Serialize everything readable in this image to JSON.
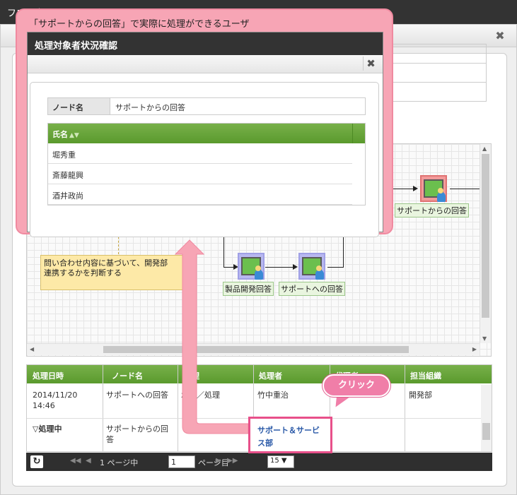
{
  "background": {
    "titlebar": "フロー表示",
    "close_icon": "close-icon",
    "flow": {
      "nodes": [
        {
          "id": "product",
          "label": "製品開発回答",
          "active": false
        },
        {
          "id": "support_to",
          "label": "サポートへの回答",
          "active": false
        },
        {
          "id": "support_from",
          "label": "サポートからの回答",
          "active": true
        }
      ],
      "note": "問い合わせ内容に基づいて、開発部\n連携するかを判断する"
    },
    "history": {
      "columns": [
        "処理日時",
        "ノード名",
        "処理",
        "処理者",
        "代理者",
        "担当組織"
      ],
      "rows": [
        {
          "date": "2014/11/20\n14:46",
          "node": "サポートへの回答",
          "action": "承認／処理",
          "processor": "竹中重治",
          "proxy": "",
          "org": "開発部"
        },
        {
          "date": "▽処理中",
          "node": "サポートからの回\n答",
          "action": "",
          "processor": "サポート＆サービ\nス部",
          "proxy": "",
          "org": ""
        }
      ]
    },
    "pager": {
      "refresh_icon": "refresh-icon",
      "page_prefix": "1 ページ中",
      "page_value": "1",
      "page_suffix": "ページ目",
      "size": "15 ▼"
    }
  },
  "callout": {
    "title": "「サポートからの回答」で実際に処理ができるユーザ",
    "dialog": {
      "title": "処理対象者状況確認",
      "node_name_label": "ノード名",
      "node_name_value": "サポートからの回答",
      "users_header": "氏名",
      "users": [
        "堀秀重",
        "斎藤龍興",
        "酒井政尚"
      ]
    }
  },
  "annotation": {
    "click_label": "クリック"
  },
  "colors": {
    "accent_green": "#5a9a2d",
    "callout_pink": "#f7a5b5",
    "highlight_pink": "#e8508a",
    "dark_bar": "#333333"
  }
}
